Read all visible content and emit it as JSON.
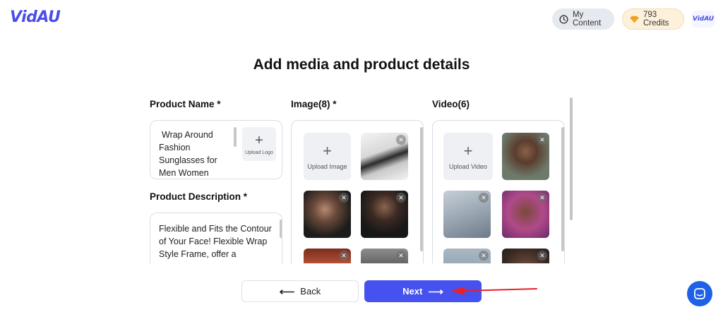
{
  "header": {
    "logo_text": "VidAU",
    "my_content_label": "My Content",
    "credits_label": "793 Credits",
    "avatar_text": "VidAU"
  },
  "page": {
    "title": "Add media and product details"
  },
  "product_name": {
    "label": "Product Name *",
    "value_lines": [
      "Wrap Around",
      "Fashion",
      "Sunglasses for",
      "Men Women"
    ],
    "upload_logo_label": "Upload Logo"
  },
  "product_description": {
    "label": "Product Description *",
    "value_lines": [
      "Flexible and Fits the Contour",
      "of Your Face! Flexible Wrap",
      "Style Frame, offer a"
    ]
  },
  "images": {
    "label": "Image(8) *",
    "upload_label": "Upload Image",
    "items": [
      {
        "photo": "white wraparound sunglasses"
      },
      {
        "photo": "woman wearing sunglasses"
      },
      {
        "photo": "woman in black holding bottle"
      },
      {
        "photo": "group photo"
      },
      {
        "photo": "street portrait"
      }
    ]
  },
  "videos": {
    "label": "Video(6)",
    "upload_label": "Upload Video",
    "items": [
      {
        "photo": "man in suit with sunglasses"
      },
      {
        "photo": "hand holding sunglasses"
      },
      {
        "photo": "woman with white sunglasses"
      },
      {
        "photo": "woman outdoors"
      },
      {
        "photo": "woman portrait"
      }
    ]
  },
  "actions": {
    "back_label": "Back",
    "next_label": "Next"
  },
  "colors": {
    "brand": "#4b4ee6",
    "primary_button": "#4552f0",
    "chat_button": "#1e61e6",
    "annotation_arrow": "#e8202a"
  },
  "icons": {
    "my_content": "clock-icon",
    "credits": "diamond-icon",
    "back": "arrow-left-icon",
    "next": "arrow-right-icon",
    "chat": "chat-icon"
  }
}
